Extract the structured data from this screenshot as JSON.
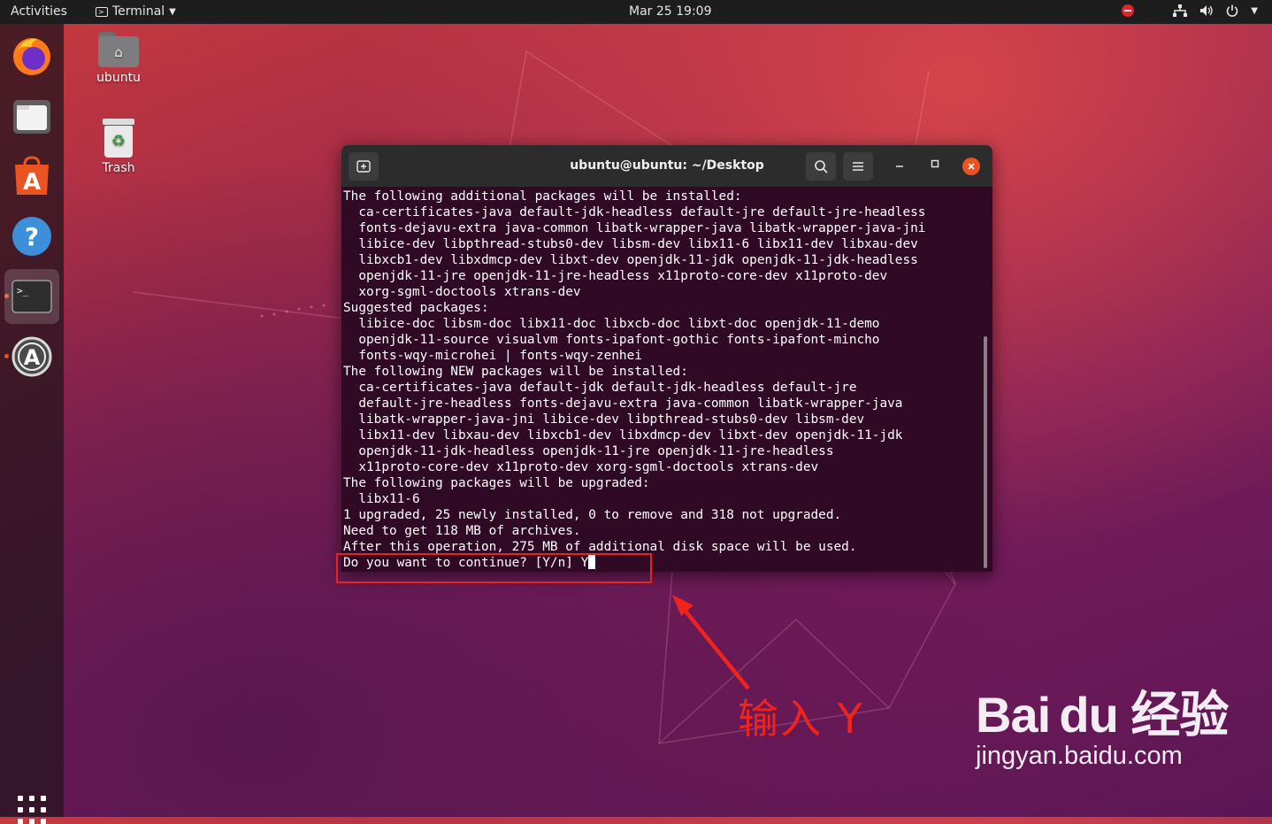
{
  "topbar": {
    "activities": "Activities",
    "app_name": "Terminal",
    "clock": "Mar 25  19:09"
  },
  "desktop": {
    "home_label": "ubuntu",
    "trash_label": "Trash"
  },
  "terminal": {
    "title": "ubuntu@ubuntu: ~/Desktop",
    "lines": [
      "The following additional packages will be installed:",
      "  ca-certificates-java default-jdk-headless default-jre default-jre-headless",
      "  fonts-dejavu-extra java-common libatk-wrapper-java libatk-wrapper-java-jni",
      "  libice-dev libpthread-stubs0-dev libsm-dev libx11-6 libx11-dev libxau-dev",
      "  libxcb1-dev libxdmcp-dev libxt-dev openjdk-11-jdk openjdk-11-jdk-headless",
      "  openjdk-11-jre openjdk-11-jre-headless x11proto-core-dev x11proto-dev",
      "  xorg-sgml-doctools xtrans-dev",
      "Suggested packages:",
      "  libice-doc libsm-doc libx11-doc libxcb-doc libxt-doc openjdk-11-demo",
      "  openjdk-11-source visualvm fonts-ipafont-gothic fonts-ipafont-mincho",
      "  fonts-wqy-microhei | fonts-wqy-zenhei",
      "The following NEW packages will be installed:",
      "  ca-certificates-java default-jdk default-jdk-headless default-jre",
      "  default-jre-headless fonts-dejavu-extra java-common libatk-wrapper-java",
      "  libatk-wrapper-java-jni libice-dev libpthread-stubs0-dev libsm-dev",
      "  libx11-dev libxau-dev libxcb1-dev libxdmcp-dev libxt-dev openjdk-11-jdk",
      "  openjdk-11-jdk-headless openjdk-11-jre openjdk-11-jre-headless",
      "  x11proto-core-dev x11proto-dev xorg-sgml-doctools xtrans-dev",
      "The following packages will be upgraded:",
      "  libx11-6",
      "1 upgraded, 25 newly installed, 0 to remove and 318 not upgraded.",
      "Need to get 118 MB of archives.",
      "After this operation, 275 MB of additional disk space will be used."
    ],
    "prompt": "Do you want to continue? [Y/n] Y"
  },
  "annotation": {
    "text": "输入 Y",
    "color": "#e5261f"
  },
  "watermark": {
    "logo": "Bai du 经验",
    "url": "jingyan.baidu.com"
  },
  "dock": {
    "items": [
      "firefox-icon",
      "files-icon",
      "software-icon",
      "help-icon",
      "terminal-icon",
      "updater-icon",
      "show-apps-icon"
    ]
  }
}
